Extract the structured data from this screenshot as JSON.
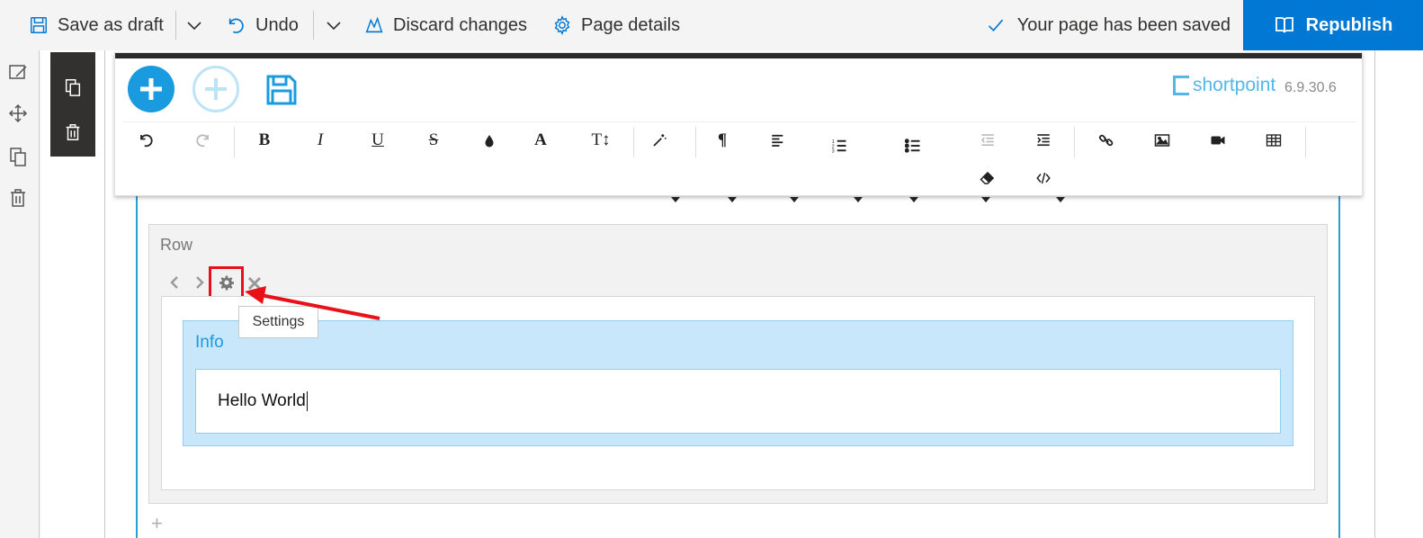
{
  "commandbar": {
    "save_draft": "Save as draft",
    "undo": "Undo",
    "discard": "Discard changes",
    "page_details": "Page details",
    "status": "Your page has been saved",
    "republish": "Republish"
  },
  "shortpoint": {
    "logo": "shortpoint",
    "version": "6.9.30.6"
  },
  "toolbar": {
    "bold": "B",
    "italic": "I",
    "underline": "U",
    "strike": "S",
    "font_color": "A",
    "font_size": "T↕",
    "paragraph": "¶"
  },
  "row": {
    "label": "Row",
    "tooltip": "Settings"
  },
  "info": {
    "label": "Info",
    "text": "Hello World"
  },
  "colors": {
    "accent": "#0078d4",
    "shortpoint_blue": "#1a9be0",
    "highlight_red": "#e8111a",
    "info_bg": "#c8e7fb"
  }
}
